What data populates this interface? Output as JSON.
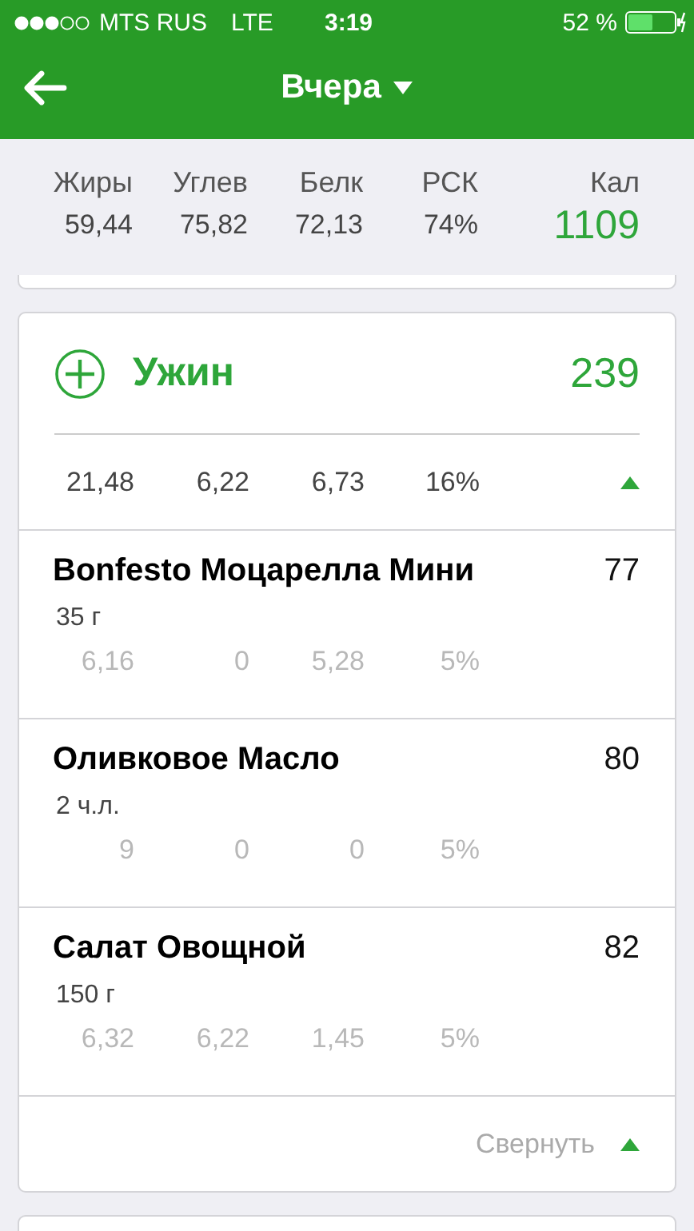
{
  "status_bar": {
    "carrier": "MTS RUS",
    "network": "LTE",
    "time": "3:19",
    "battery": "52 %"
  },
  "header": {
    "title": "Вчера"
  },
  "summary": {
    "columns": [
      {
        "label": "Жиры",
        "value": "59,44"
      },
      {
        "label": "Углев",
        "value": "75,82"
      },
      {
        "label": "Белк",
        "value": "72,13"
      },
      {
        "label": "РСК",
        "value": "74%"
      }
    ],
    "calories": {
      "label": "Кал",
      "value": "1109"
    }
  },
  "meal": {
    "title": "Ужин",
    "calories": "239",
    "totals": [
      "21,48",
      "6,22",
      "6,73",
      "16%"
    ],
    "expanded": true,
    "items": [
      {
        "name": "Bonfesto Моцарелла Мини",
        "amount": "35 г",
        "calories": "77",
        "values": [
          "6,16",
          "0",
          "5,28",
          "5%"
        ]
      },
      {
        "name": "Оливковое Масло",
        "amount": "2 ч.л.",
        "calories": "80",
        "values": [
          "9",
          "0",
          "0",
          "5%"
        ]
      },
      {
        "name": "Салат Овощной",
        "amount": "150 г",
        "calories": "82",
        "values": [
          "6,32",
          "6,22",
          "1,45",
          "5%"
        ]
      }
    ],
    "collapse_label": "Свернуть"
  }
}
